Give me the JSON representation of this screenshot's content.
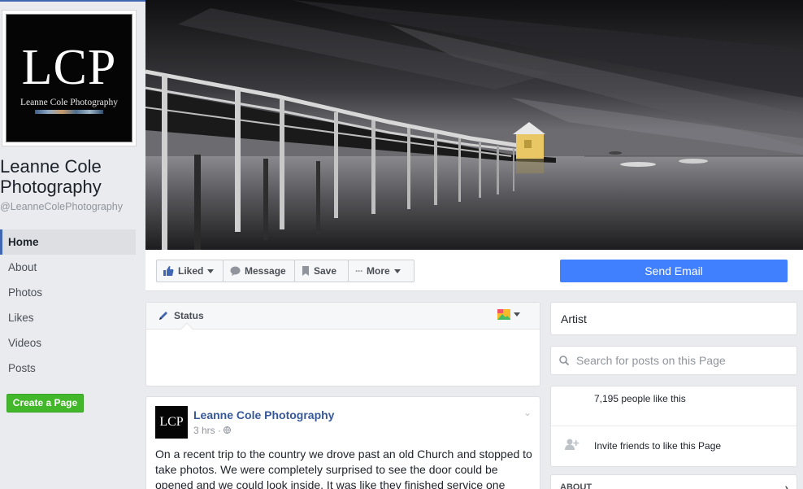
{
  "page": {
    "logo_big": "LCP",
    "logo_small": "Leanne Cole Photography",
    "name": "Leanne Cole Photography",
    "handle": "@LeanneColePhotography"
  },
  "nav": {
    "items": [
      {
        "label": "Home",
        "active": true
      },
      {
        "label": "About"
      },
      {
        "label": "Photos"
      },
      {
        "label": "Likes"
      },
      {
        "label": "Videos"
      },
      {
        "label": "Posts"
      }
    ],
    "create_page": "Create a Page"
  },
  "actions": {
    "liked": "Liked",
    "message": "Message",
    "save": "Save",
    "more": "More",
    "send_email": "Send Email"
  },
  "status": {
    "label": "Status"
  },
  "post": {
    "avatar_text": "LCP",
    "author": "Leanne Cole Photography",
    "time": "3 hrs",
    "text": "On a recent trip to the country we drove past an old Church and stopped to take photos. We were completely surprised to see the door could be opened and we could look inside. It was like they finished service one Sunday and"
  },
  "right": {
    "category": "Artist",
    "search_placeholder": "Search for posts on this Page",
    "likes_count": "7,195 people like this",
    "invite": "Invite friends to like this Page",
    "about": "ABOUT"
  },
  "colors": {
    "brand_blue": "#4267b2",
    "link_blue": "#365899",
    "send_blue": "#4080ff",
    "create_green": "#42b72a"
  }
}
